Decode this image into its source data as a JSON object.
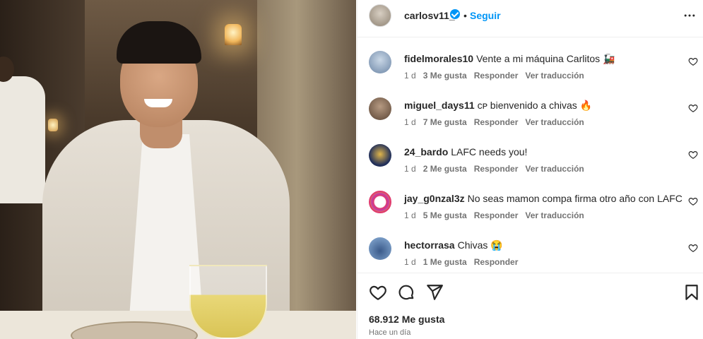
{
  "header": {
    "username": "carlosv11_",
    "dot": "•",
    "follow_label": "Seguir"
  },
  "comments": [
    {
      "username": "fidelmorales10",
      "text": "Vente a mi máquina Carlitos 🚂",
      "time": "1 d",
      "likes": "3 Me gusta",
      "reply": "Responder",
      "translate": "Ver traducción"
    },
    {
      "username": "miguel_days11",
      "text": "ᴄᴘ bienvenido a chivas 🔥",
      "time": "1 d",
      "likes": "7 Me gusta",
      "reply": "Responder",
      "translate": "Ver traducción"
    },
    {
      "username": "24_bardo",
      "text": "LAFC needs you!",
      "time": "1 d",
      "likes": "2 Me gusta",
      "reply": "Responder",
      "translate": "Ver traducción"
    },
    {
      "username": "jay_g0nzal3z",
      "text": "No seas mamon compa firma otro año con LAFC",
      "time": "1 d",
      "likes": "5 Me gusta",
      "reply": "Responder",
      "translate": "Ver traducción"
    },
    {
      "username": "hectorrasa",
      "text": "Chivas 😭",
      "time": "1 d",
      "likes": "1 Me gusta",
      "reply": "Responder"
    }
  ],
  "footer": {
    "likes": "68.912 Me gusta",
    "posted": "Hace un día"
  },
  "colors": {
    "accent": "#0095f6",
    "text": "#262626",
    "secondary": "#737373"
  },
  "icons": [
    "more-icon",
    "heart-icon",
    "comment-icon",
    "share-icon",
    "bookmark-icon",
    "verified-icon"
  ]
}
